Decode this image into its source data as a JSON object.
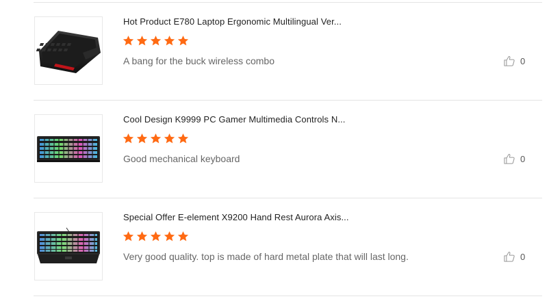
{
  "colors": {
    "star": "#ff6a13",
    "divider": "#e4e4e4",
    "title": "#222222",
    "comment": "#666666"
  },
  "icons": {
    "rating": "star-icon",
    "like": "thumbs-up-icon"
  },
  "reviews": [
    {
      "title": "Hot Product E780 Laptop Ergonomic Multilingual Ver...",
      "rating": 5,
      "comment": "A bang for the buck wireless combo",
      "likes": "0"
    },
    {
      "title": "Cool Design K9999 PC Gamer Multimedia Controls N...",
      "rating": 5,
      "comment": "Good mechanical keyboard",
      "likes": "0"
    },
    {
      "title": "Special Offer E-element X9200 Hand Rest Aurora Axis...",
      "rating": 5,
      "comment": "Very good quality. top is made of hard metal plate that will last long.",
      "likes": "0"
    }
  ]
}
